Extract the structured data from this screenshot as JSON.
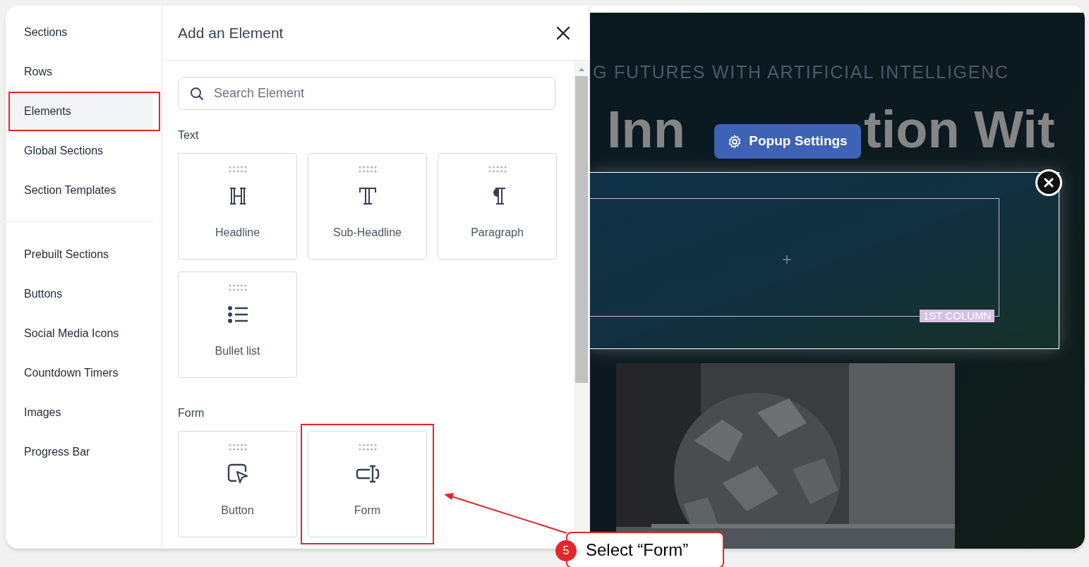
{
  "sidebar": {
    "groups": [
      {
        "items": [
          {
            "label": "Sections",
            "selected": false,
            "highlighted": false
          },
          {
            "label": "Rows",
            "selected": false,
            "highlighted": false
          },
          {
            "label": "Elements",
            "selected": true,
            "highlighted": true
          },
          {
            "label": "Global Sections",
            "selected": false,
            "highlighted": false
          },
          {
            "label": "Section Templates",
            "selected": false,
            "highlighted": false
          }
        ]
      },
      {
        "items": [
          {
            "label": "Prebuilt Sections",
            "selected": false,
            "highlighted": false
          },
          {
            "label": "Buttons",
            "selected": false,
            "highlighted": false
          },
          {
            "label": "Social Media Icons",
            "selected": false,
            "highlighted": false
          },
          {
            "label": "Countdown Timers",
            "selected": false,
            "highlighted": false
          },
          {
            "label": "Images",
            "selected": false,
            "highlighted": false
          },
          {
            "label": "Progress Bar",
            "selected": false,
            "highlighted": false
          }
        ]
      }
    ]
  },
  "panel": {
    "title": "Add an Element",
    "search": {
      "placeholder": "Search Element"
    },
    "categories": [
      {
        "title": "Text",
        "elements": [
          {
            "label": "Headline",
            "kind": "headline",
            "highlighted": false
          },
          {
            "label": "Sub-Headline",
            "kind": "subheadline",
            "highlighted": false
          },
          {
            "label": "Paragraph",
            "kind": "paragraph",
            "highlighted": false
          },
          {
            "label": "Bullet list",
            "kind": "list",
            "highlighted": false
          }
        ]
      },
      {
        "title": "Form",
        "elements": [
          {
            "label": "Button",
            "kind": "button",
            "highlighted": false
          },
          {
            "label": "Form",
            "kind": "form",
            "highlighted": true
          }
        ]
      }
    ]
  },
  "canvas": {
    "tagline": "G FUTURES WITH ARTIFICIAL INTELLIGENC",
    "heading_parts": [
      "Inn",
      "tion Wit"
    ],
    "popup_settings_button": "Popup Settings",
    "add_symbol": "+",
    "column_label": "1ST COLUMN"
  },
  "callout": {
    "number": "5",
    "text": "Select “Form”"
  }
}
